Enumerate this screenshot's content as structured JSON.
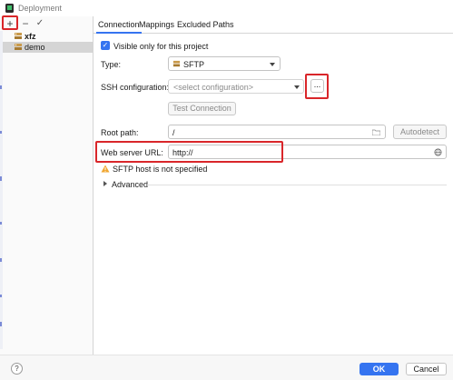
{
  "window": {
    "title": "Deployment"
  },
  "left_toolbar": {
    "add": "+",
    "remove": "−",
    "apply": "✓"
  },
  "servers": [
    {
      "name": "xfz",
      "bold": true,
      "selected": false
    },
    {
      "name": "demo",
      "bold": false,
      "selected": true
    }
  ],
  "tabs": [
    {
      "label": "Connection",
      "active": true
    },
    {
      "label": "Mappings",
      "active": false
    },
    {
      "label": "Excluded Paths",
      "active": false
    }
  ],
  "form": {
    "visible_only_label": "Visible only for this project",
    "visible_only_checked": true,
    "type_label": "Type:",
    "type_value": "SFTP",
    "ssh_label": "SSH configuration:",
    "ssh_placeholder": "<select configuration>",
    "ssh_more_button": "...",
    "test_connection_button": "Test Connection",
    "root_path_label": "Root path:",
    "root_path_value": "/",
    "autodetect_button": "Autodetect",
    "web_server_url_label": "Web server URL:",
    "web_server_url_value": "http://",
    "warning_text": "SFTP host is not specified",
    "advanced_label": "Advanced"
  },
  "footer": {
    "help": "?",
    "ok_button": "OK",
    "cancel_button": "Cancel"
  },
  "colors": {
    "accent": "#3574f0",
    "highlight_red": "#d9262a",
    "selection": "#d5d5d5",
    "warning": "#f0a732"
  },
  "icons": {
    "app": "deployment-app-icon",
    "server": "sftp-server-icon",
    "folder": "folder-icon",
    "globe": "globe-icon",
    "warning": "warning-icon"
  }
}
